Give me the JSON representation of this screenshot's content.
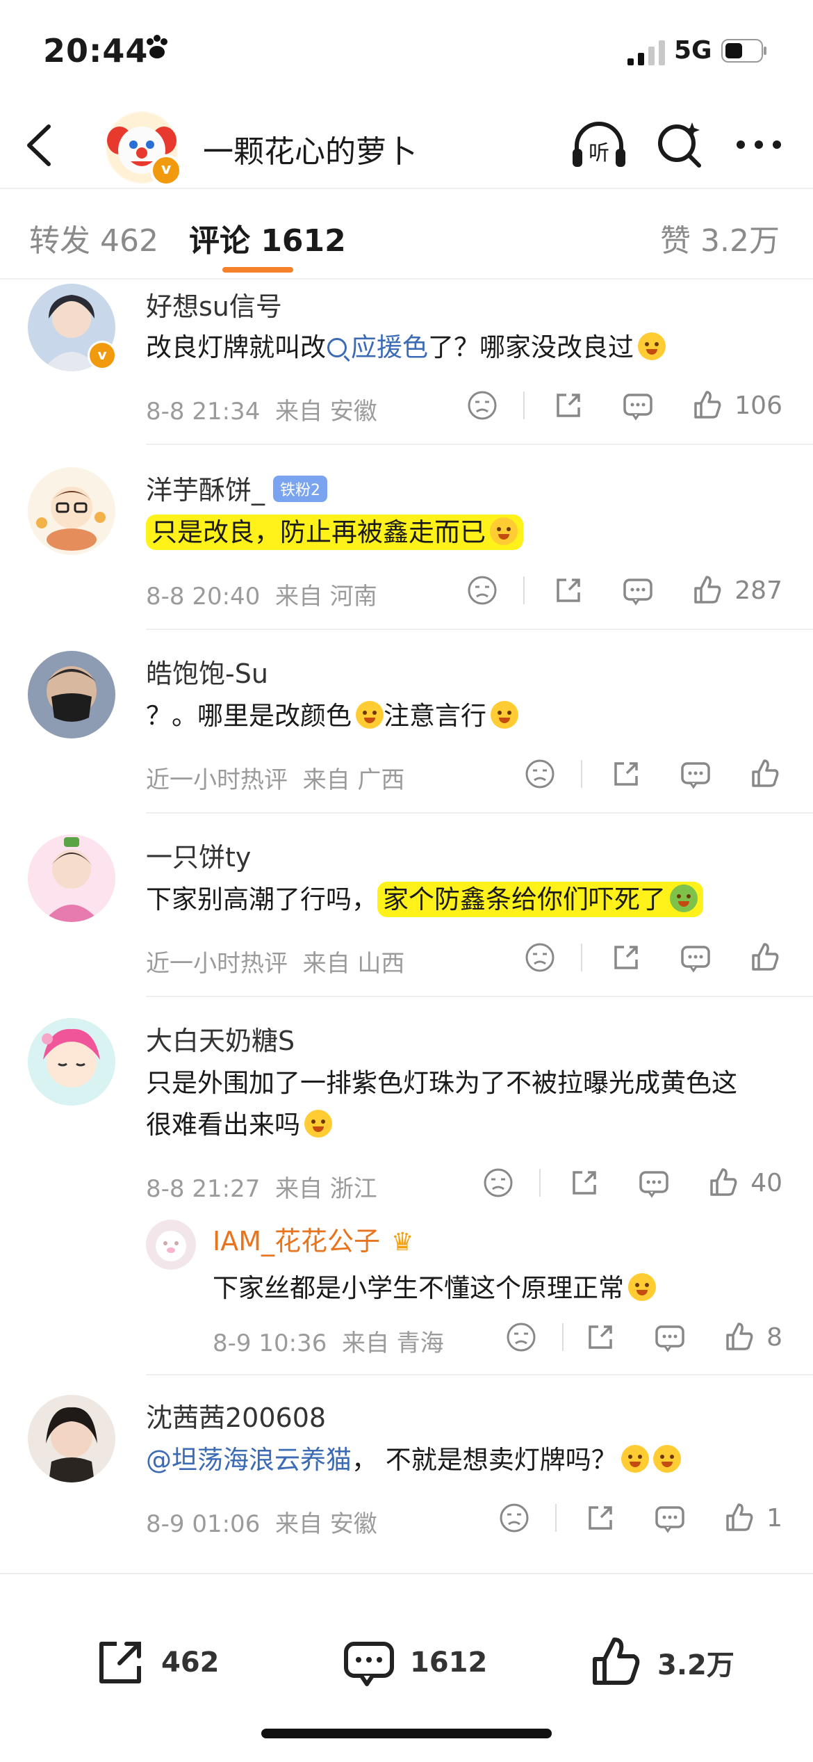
{
  "status_bar": {
    "time": "20:44",
    "network": "5G"
  },
  "header": {
    "title": "一颗花心的萝卜",
    "verified": "v"
  },
  "tabs": {
    "forward": "转发 462",
    "comment": "评论 1612",
    "like": "赞 3.2万"
  },
  "comments": [
    {
      "name": "好想su信号",
      "text_before": "改良灯牌就叫改",
      "search_link": "应援色",
      "text_after": "了？哪家没改良过",
      "time": "8-8 21:34",
      "source": "来自 安徽",
      "likes": "106"
    },
    {
      "name": "洋芋酥饼_",
      "badge": "铁粉2",
      "text": "只是改良，防止再被鑫走而已",
      "time": "8-8 20:40",
      "source": "来自 河南",
      "likes": "287"
    },
    {
      "name": "皓饱饱-Su",
      "text_a": "？。哪里是改颜色",
      "text_b": "注意言行",
      "time": "近一小时热评",
      "source": "来自 广西"
    },
    {
      "name": "一只饼ty",
      "text_plain": "下家别高潮了行吗，",
      "text_highlight": "家个防鑫条给你们吓死了",
      "time": "近一小时热评",
      "source": "来自 山西"
    },
    {
      "name": "大白天奶糖S",
      "text_line1": "只是外围加了一排紫色灯珠为了不被拉曝光成黄色这",
      "text_line2": "很难看出来吗",
      "time": "8-8 21:27",
      "source": "来自 浙江",
      "likes": "40",
      "reply": {
        "name": "IAM_花花公子",
        "text": "下家丝都是小学生不懂这个原理正常",
        "time": "8-9 10:36",
        "source": "来自 青海",
        "likes": "8"
      }
    },
    {
      "name": "沈茜茜200608",
      "mention": "@坦荡海浪云养猫",
      "text": "， 不就是想卖灯牌吗？",
      "time": "8-9 01:06",
      "source": "来自 安徽",
      "likes": "1"
    }
  ],
  "bottom_bar": {
    "forward": "462",
    "comment": "1612",
    "like": "3.2万"
  },
  "colors": {
    "accent": "#f5822a",
    "highlight": "#fff21a",
    "link": "#3c6bb5",
    "reply_name": "#e8741e"
  }
}
